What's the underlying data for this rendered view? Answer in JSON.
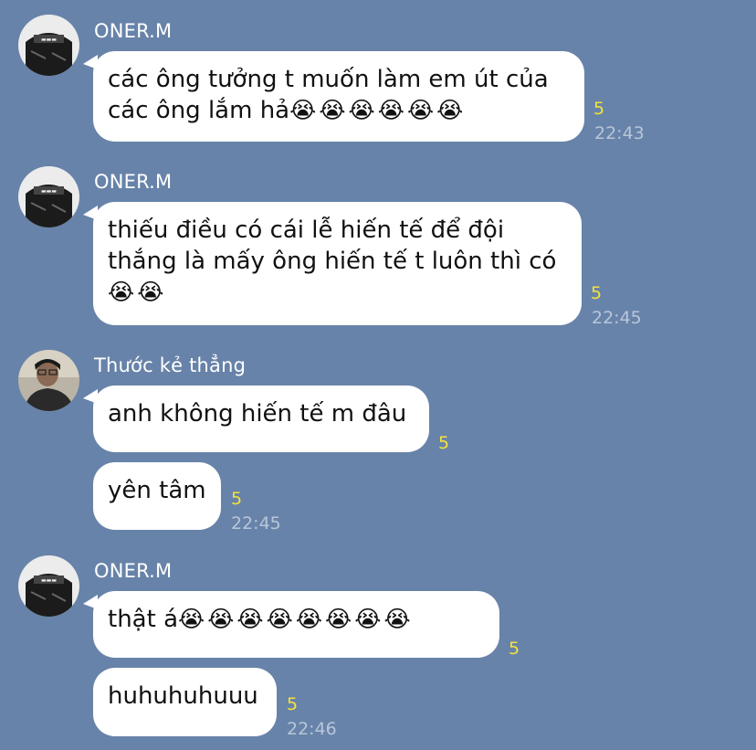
{
  "chat": {
    "groups": [
      {
        "sender": "ONER.M",
        "avatar_icon": "oner-avatar-icon",
        "messages": [
          {
            "line1": "các ông tưởng t muốn làm em út của",
            "line2": "các ông lắm hả",
            "emoji": "😭😭😭😭😭😭",
            "read": "5",
            "time": "22:43"
          }
        ]
      },
      {
        "sender": "ONER.M",
        "avatar_icon": "oner-avatar-icon",
        "messages": [
          {
            "line1": "thiếu điều có cái lễ hiến tế để đội",
            "line2": "thắng là mấy ông hiến tế t luôn thì có",
            "emoji": "😭😭",
            "read": "5",
            "time": "22:45"
          }
        ]
      },
      {
        "sender": "Thước kẻ thẳng",
        "avatar_icon": "user-photo-avatar-icon",
        "messages": [
          {
            "text": "anh không hiến tế m đâu",
            "read": "5"
          },
          {
            "text": "yên tâm",
            "read": "5",
            "time": "22:45"
          }
        ]
      },
      {
        "sender": "ONER.M",
        "avatar_icon": "oner-avatar-icon",
        "messages": [
          {
            "text": "thật á",
            "emoji": "😭😭😭😭😭😭😭😭",
            "read": "5"
          },
          {
            "text": "huhuhuhuuu",
            "read": "5",
            "time": "22:46"
          }
        ]
      }
    ]
  },
  "colors": {
    "background": "#6883a9",
    "bubble": "#ffffff",
    "read_count": "#f5e33b",
    "timestamp": "#b8c6da"
  }
}
